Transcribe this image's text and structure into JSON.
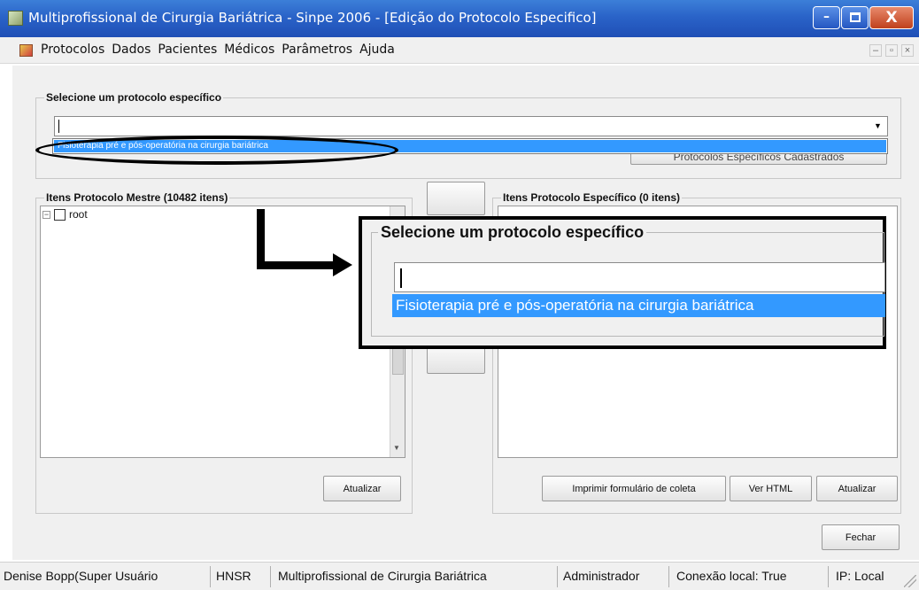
{
  "window": {
    "title": "Multiprofissional de Cirurgia Bariátrica - Sinpe 2006 - [Edição do Protocolo Especifico]",
    "min_symbol": "–",
    "close_symbol": "X"
  },
  "menu": {
    "items": [
      "Protocolos",
      "Dados",
      "Pacientes",
      "Médicos",
      "Parâmetros",
      "Ajuda"
    ],
    "mdi_min": "–",
    "mdi_restore": "▫",
    "mdi_close": "×"
  },
  "selector": {
    "group_title": "Selecione um protocolo específico",
    "combo_value": "",
    "selected_option": "Fisioterapia pré e pós-operatória na cirurgia bariátrica",
    "registered_button": "Protocolos Específicos Cadastrados"
  },
  "master": {
    "group_title": "Itens Protocolo Mestre (10482 itens)",
    "tree_root": "root",
    "refresh_button": "Atualizar"
  },
  "specific": {
    "group_title": "Itens Protocolo Específico (0 itens)",
    "print_button": "Imprimir formulário de coleta",
    "html_button": "Ver HTML",
    "refresh_button": "Atualizar"
  },
  "close_button": "Fechar",
  "callout": {
    "group_title": "Selecione um protocolo específico",
    "combo_value": "",
    "selected_option": "Fisioterapia pré e pós-operatória na cirurgia bariátrica"
  },
  "status": {
    "user": "Denise Bopp(Super Usuário",
    "unit": "HNSR",
    "module": "Multiprofissional de Cirurgia Bariátrica",
    "role": "Administrador",
    "connection": "Conexão local: True",
    "ip": "IP: Local"
  },
  "colors": {
    "titlebar": "#2a63c8",
    "selection": "#3399ff",
    "client": "#f0f0f0"
  }
}
